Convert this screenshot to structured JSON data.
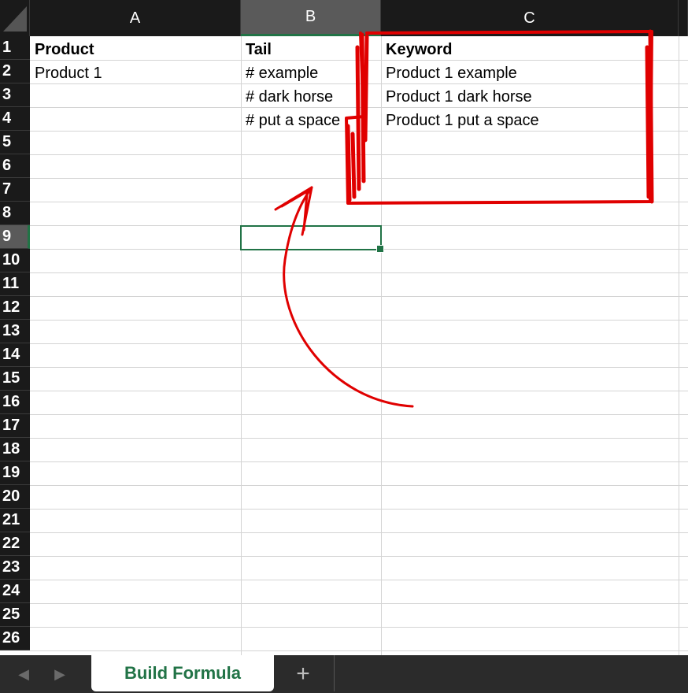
{
  "columns": [
    {
      "letter": "A"
    },
    {
      "letter": "B"
    },
    {
      "letter": "C"
    }
  ],
  "rows": [
    "1",
    "2",
    "3",
    "4",
    "5",
    "6",
    "7",
    "8",
    "9",
    "10",
    "11",
    "12",
    "13",
    "14",
    "15",
    "16",
    "17",
    "18",
    "19",
    "20",
    "21",
    "22",
    "23",
    "24",
    "25",
    "26"
  ],
  "cells": {
    "A1": "Product",
    "B1": "Tail",
    "C1": "Keyword",
    "A2": "Product 1",
    "B2": "# example",
    "C2": "Product 1 example",
    "B3": "# dark horse",
    "C3": "Product 1 dark horse",
    "B4": "# put a space",
    "C4": "Product 1 put a space"
  },
  "selected_cell": "B9",
  "sheet_tabs": [
    {
      "label": "Build Formula",
      "active": true
    }
  ],
  "add_sheet_label": "+",
  "colors": {
    "header_bg": "#1a1a1a",
    "selected_header_bg": "#5a5a5a",
    "accent_green": "#217346",
    "annotation_red": "#e00000"
  },
  "icons": {
    "nav_prev": "chevron-left-icon",
    "nav_next": "chevron-right-icon",
    "add_sheet": "plus-icon"
  }
}
